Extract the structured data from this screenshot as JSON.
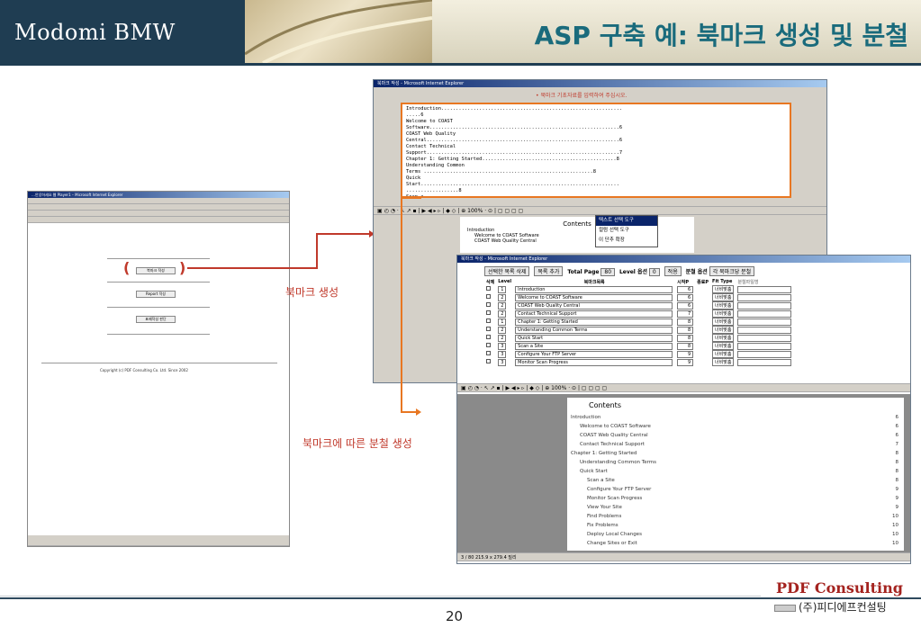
{
  "header": {
    "brand": "Modomi BMW",
    "title": "ASP 구축 예: 북마크 생성 및 분철"
  },
  "labels": {
    "bookmark_create": "북마크 생성",
    "split_by_bookmark": "북마크에 따른 분철 생성"
  },
  "left_window": {
    "title": "…안녕하세요 웹 Player1 – Microsoft Internet Explorer",
    "btn1": "북마크 작성",
    "btn2": "Report 작성",
    "btn3": "표제작성 판단",
    "copyright": "Copyright (c) PDF Consulting Co. Ltd. Since 2002"
  },
  "main_window": {
    "title": "북마크 작성 - Microsoft Internet Explorer",
    "instruction": "• 북마크 기초자료를 입력하여 주십시오.",
    "textarea": "Introduction..............................................................\n.....6\nWelcome to COAST\nSoftware.................................................................6\nCOAST Web Quality\nCentral..................................................................6\nContact Technical\nSupport..................................................................7\nChapter 1: Getting Started..............................................8\nUnderstanding Common\nTerms ..........................................................8\nQuick\nStart....................................................................\n..................8\nScan a",
    "toolbar": "▣ ◴ ◔ · ↖ ↗ ▪ | ▶ ◀ ▸ ▹ | ◆ ◇ | ⊕ 100% · ⊙ | ▢ ▢ ▢ ▢",
    "pdf_title": "Contents",
    "pdf_row1": "Introduction",
    "pdf_row2": "Welcome to COAST Software",
    "pdf_row3": "COAST Web Quality Central",
    "menu": [
      "텍스트 선택 도구",
      "컬럼 선택 도구",
      "이 단추 확장"
    ]
  },
  "second_window": {
    "title": "북마크 작성 - Microsoft Internet Explorer",
    "controls": {
      "btn1": "선택한 목록 삭제",
      "btn2": "목록 추가",
      "total_label": "Total Page",
      "total_value": "80",
      "level_label": "Level 옵션",
      "level_value": "0",
      "apply": "적용",
      "split_label": "분철 옵션",
      "split_value": "각 북마크당 분철"
    },
    "headers": [
      "삭제",
      "Level",
      "북마크목록",
      "시작P",
      "종료P",
      "Fit Type",
      "분철파일명"
    ],
    "rows": [
      {
        "level": "1",
        "name": "Introduction",
        "start": "6",
        "fit": "너비맞춤"
      },
      {
        "level": "2",
        "name": "Welcome to COAST Software",
        "start": "6",
        "fit": "너비맞춤"
      },
      {
        "level": "2",
        "name": "COAST Web Quality Central",
        "start": "6",
        "fit": "너비맞춤"
      },
      {
        "level": "2",
        "name": "Contact Technical Support",
        "start": "7",
        "fit": "너비맞춤"
      },
      {
        "level": "1",
        "name": "Chapter 1: Getting Started",
        "start": "8",
        "fit": "너비맞춤"
      },
      {
        "level": "2",
        "name": "Understanding Common Terms",
        "start": "8",
        "fit": "너비맞춤"
      },
      {
        "level": "2",
        "name": "Quick Start",
        "start": "8",
        "fit": "너비맞춤"
      },
      {
        "level": "3",
        "name": "Scan a Site",
        "start": "8",
        "fit": "너비맞춤"
      },
      {
        "level": "3",
        "name": "Configure Your FTP Server",
        "start": "9",
        "fit": "너비맞춤"
      },
      {
        "level": "3",
        "name": "Monitor Scan Progress",
        "start": "9",
        "fit": "너비맞춤"
      }
    ],
    "pdf_title": "Contents",
    "pdf_rows": [
      {
        "t": "Introduction",
        "p": "6"
      },
      {
        "t": "Welcome to COAST Software",
        "p": "6"
      },
      {
        "t": "COAST Web Quality Central",
        "p": "6"
      },
      {
        "t": "Contact Technical Support",
        "p": "7"
      },
      {
        "t": "Chapter 1:  Getting Started",
        "p": "8"
      },
      {
        "t": "Understanding Common Terms",
        "p": "8"
      },
      {
        "t": "Quick Start",
        "p": "8"
      },
      {
        "t": "Scan a Site",
        "p": "8"
      },
      {
        "t": "Configure Your FTP Server",
        "p": "9"
      },
      {
        "t": "Monitor Scan Progress",
        "p": "9"
      },
      {
        "t": "View Your Site",
        "p": "9"
      },
      {
        "t": "Find Problems",
        "p": "10"
      },
      {
        "t": "Fix Problems",
        "p": "10"
      },
      {
        "t": "Deploy Local Changes",
        "p": "10"
      },
      {
        "t": "Change Sites or Exit",
        "p": "10"
      }
    ],
    "status": "3 / 80   215.9 x 279.4 밀리"
  },
  "footer": {
    "page": "20",
    "brand": "PDF Consulting",
    "company": "(주)피디에프컨설팅"
  },
  "colors": {
    "accent_red": "#c0392b",
    "accent_orange": "#e87722",
    "header_dark": "#1f3d52"
  }
}
